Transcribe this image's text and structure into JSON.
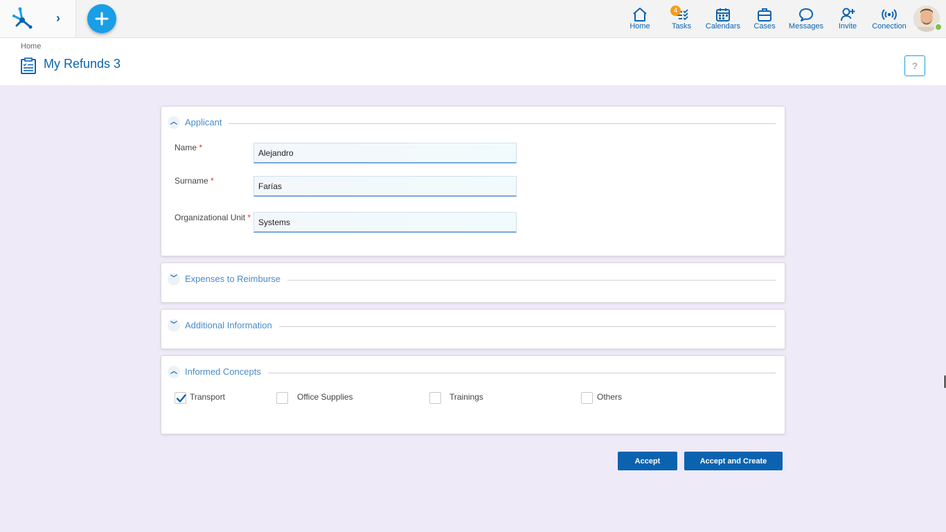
{
  "topbar": {
    "nav": [
      {
        "label": "Home",
        "icon": "home-icon"
      },
      {
        "label": "Tasks",
        "icon": "tasks-icon",
        "badge": "4"
      },
      {
        "label": "Calendars",
        "icon": "calendar-icon"
      },
      {
        "label": "Cases",
        "icon": "briefcase-icon"
      },
      {
        "label": "Messages",
        "icon": "message-icon"
      },
      {
        "label": "Invite",
        "icon": "add-user-icon"
      },
      {
        "label": "Conection",
        "icon": "connection-icon"
      }
    ],
    "status": "online"
  },
  "header": {
    "breadcrumb": "Home",
    "title": "My Refunds 3",
    "help": "?"
  },
  "applicant": {
    "title": "Applicant",
    "expanded": true,
    "fields": [
      {
        "label": "Name",
        "value": "Alejandro",
        "required": "*"
      },
      {
        "label": "Surname",
        "value": "Farías",
        "required": "*"
      },
      {
        "label": "Organizational Unit",
        "value": "Systems",
        "required": "*"
      }
    ]
  },
  "expenses": {
    "title": "Expenses to Reimburse",
    "expanded": false
  },
  "additional": {
    "title": "Additional Information",
    "expanded": false
  },
  "concepts": {
    "title": "Informed Concepts",
    "expanded": true,
    "items": [
      {
        "label": "Transport",
        "checked": true
      },
      {
        "label": "Office Supplies",
        "checked": false
      },
      {
        "label": "Trainings",
        "checked": false
      },
      {
        "label": "Others",
        "checked": false
      }
    ]
  },
  "actions": {
    "accept": "Accept",
    "accept_create": "Accept and Create"
  },
  "colors": {
    "primary": "#0b63b0",
    "accent": "#1a9ee6",
    "badge": "#f39c1a",
    "background": "#efeaf7"
  }
}
